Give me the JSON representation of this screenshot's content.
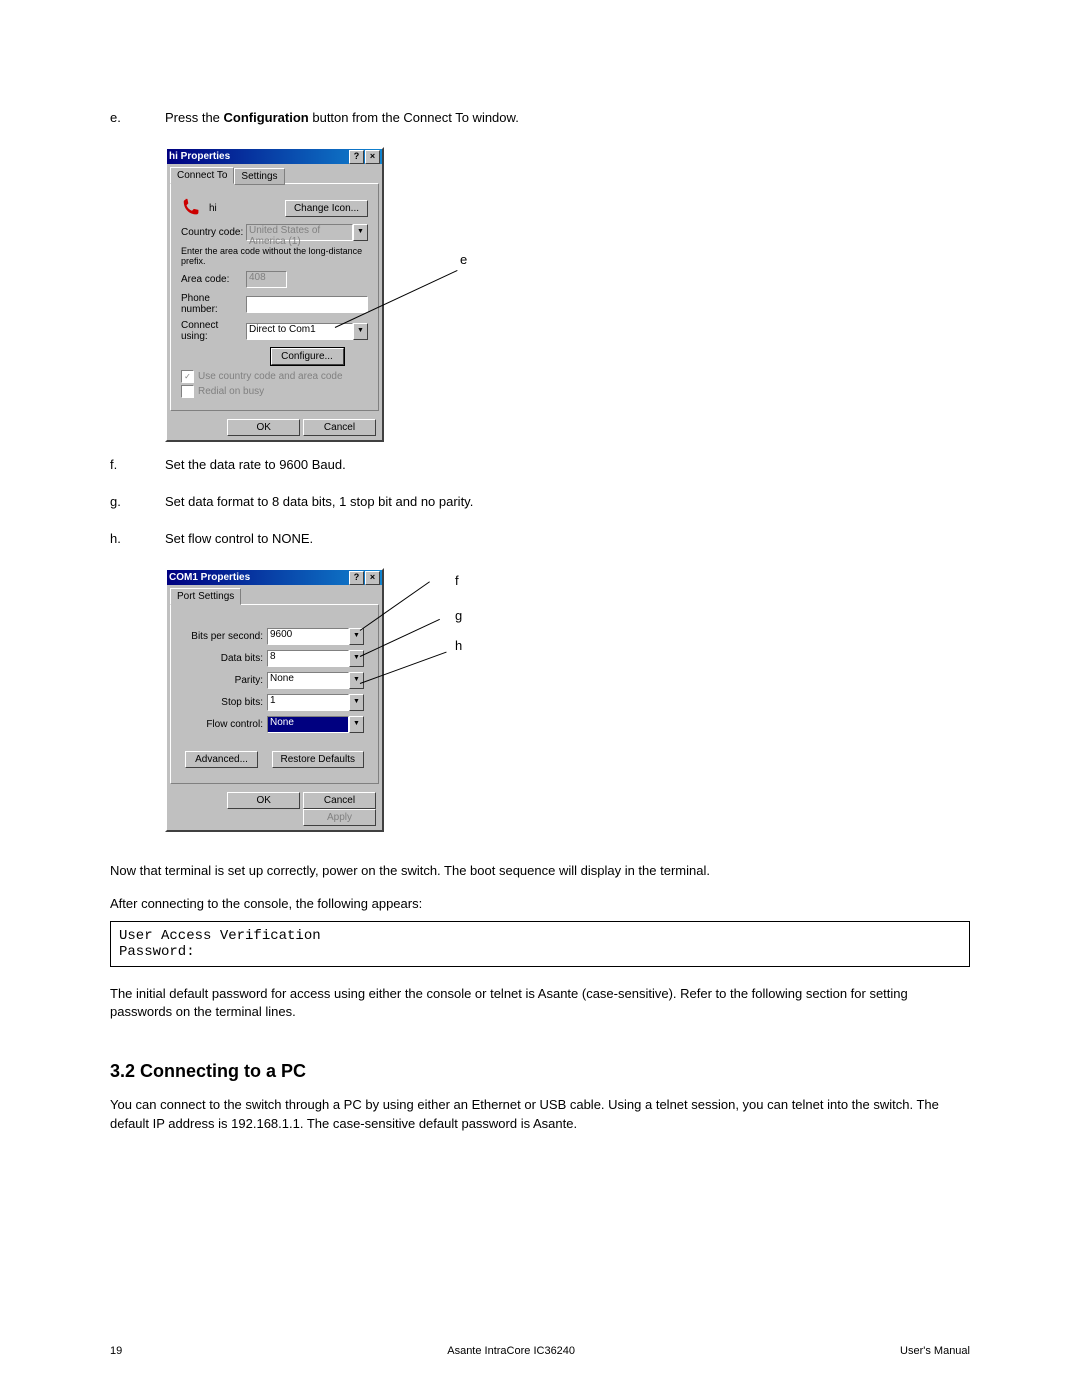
{
  "steps": {
    "e": {
      "letter": "e.",
      "pre": "Press the ",
      "bold": "Configuration",
      "post": " button from the Connect To window."
    },
    "f": {
      "letter": "f.",
      "text": "Set the data rate to 9600 Baud."
    },
    "g": {
      "letter": "g.",
      "text": "Set data format to 8 data bits, 1 stop bit and no parity."
    },
    "h": {
      "letter": "h.",
      "text": "Set flow control to NONE."
    }
  },
  "dialog1": {
    "title": "hi Properties",
    "tabs": {
      "connect": "Connect To",
      "settings": "Settings"
    },
    "iconlabel": "hi",
    "change_icon": "Change Icon...",
    "country_label": "Country code:",
    "country_value": "United States of America (1)",
    "prefix_note": "Enter the area code without the long-distance prefix.",
    "area_label": "Area code:",
    "area_value": "408",
    "phone_label": "Phone number:",
    "phone_value": "",
    "connect_label": "Connect using:",
    "connect_value": "Direct to Com1",
    "configure_btn": "Configure...",
    "chk1": "Use country code and area code",
    "chk2": "Redial on busy",
    "ok": "OK",
    "cancel": "Cancel"
  },
  "dialog2": {
    "title": "COM1 Properties",
    "tab": "Port Settings",
    "bits_label": "Bits per second:",
    "bits_value": "9600",
    "data_label": "Data bits:",
    "data_value": "8",
    "parity_label": "Parity:",
    "parity_value": "None",
    "stop_label": "Stop bits:",
    "stop_value": "1",
    "flow_label": "Flow control:",
    "flow_value": "None",
    "advanced": "Advanced...",
    "restore": "Restore Defaults",
    "ok": "OK",
    "cancel": "Cancel",
    "apply": "Apply"
  },
  "callouts": {
    "e": "e",
    "f": "f",
    "g": "g",
    "h": "h"
  },
  "body_text": {
    "p1": "Now that terminal is set up correctly, power on the switch. The boot sequence will display in the terminal.",
    "p2": "After connecting to the console, the following appears:",
    "term_line1": "User Access Verification",
    "term_line2": "Password:",
    "p3": "The initial default password for access using either the console or telnet is Asante (case-sensitive). Refer to the following section for setting passwords on the terminal lines.",
    "section": "3.2 Connecting to a PC",
    "p4": "You can connect to the switch through a PC by using either an Ethernet or USB cable. Using a telnet session, you can telnet into the switch. The default IP address is 192.168.1.1. The case-sensitive default password is Asante."
  },
  "footer": {
    "page": "19",
    "product": "Asante IntraCore IC36240",
    "doc": "User's Manual"
  }
}
